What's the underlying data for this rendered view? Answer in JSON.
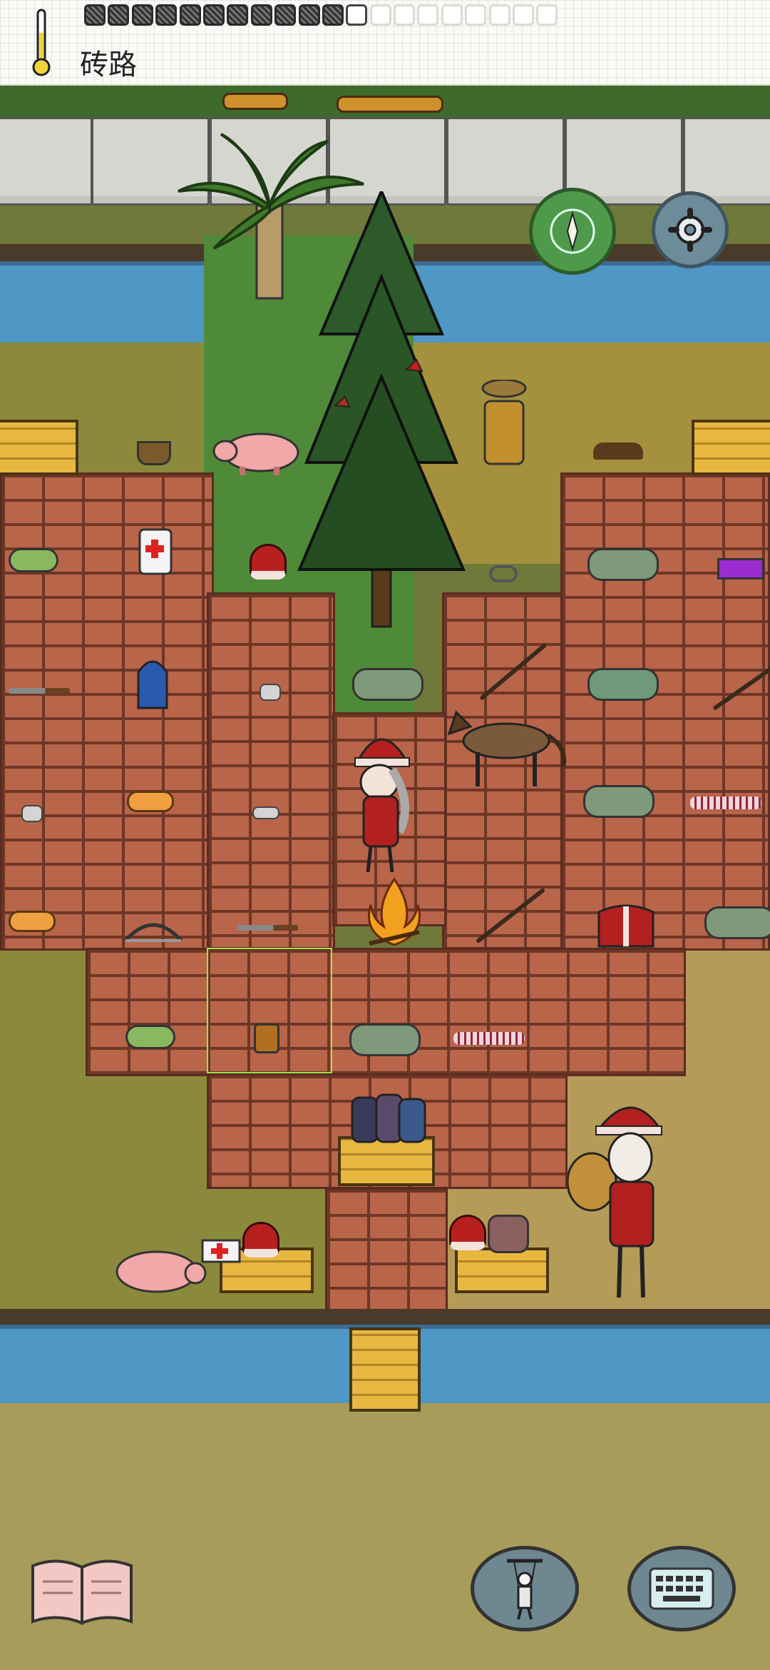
{
  "hud": {
    "location_name": "砖路",
    "food_slots": [
      "full",
      "full",
      "full",
      "full",
      "full",
      "full",
      "full",
      "full",
      "full",
      "full",
      "full",
      "empty",
      "faint",
      "faint",
      "faint",
      "faint",
      "faint",
      "faint",
      "faint",
      "faint"
    ]
  },
  "controls": {
    "compass_icon": "compass-icon",
    "settings_icon": "gear-icon",
    "book_icon": "open-book-icon",
    "emote_icon": "puppet-icon",
    "keyboard_icon": "keyboard-icon"
  },
  "colors": {
    "brick": "#b8654a",
    "river": "#4f97c4",
    "grass": "#4f8a39",
    "selector": "#9fe04a"
  }
}
